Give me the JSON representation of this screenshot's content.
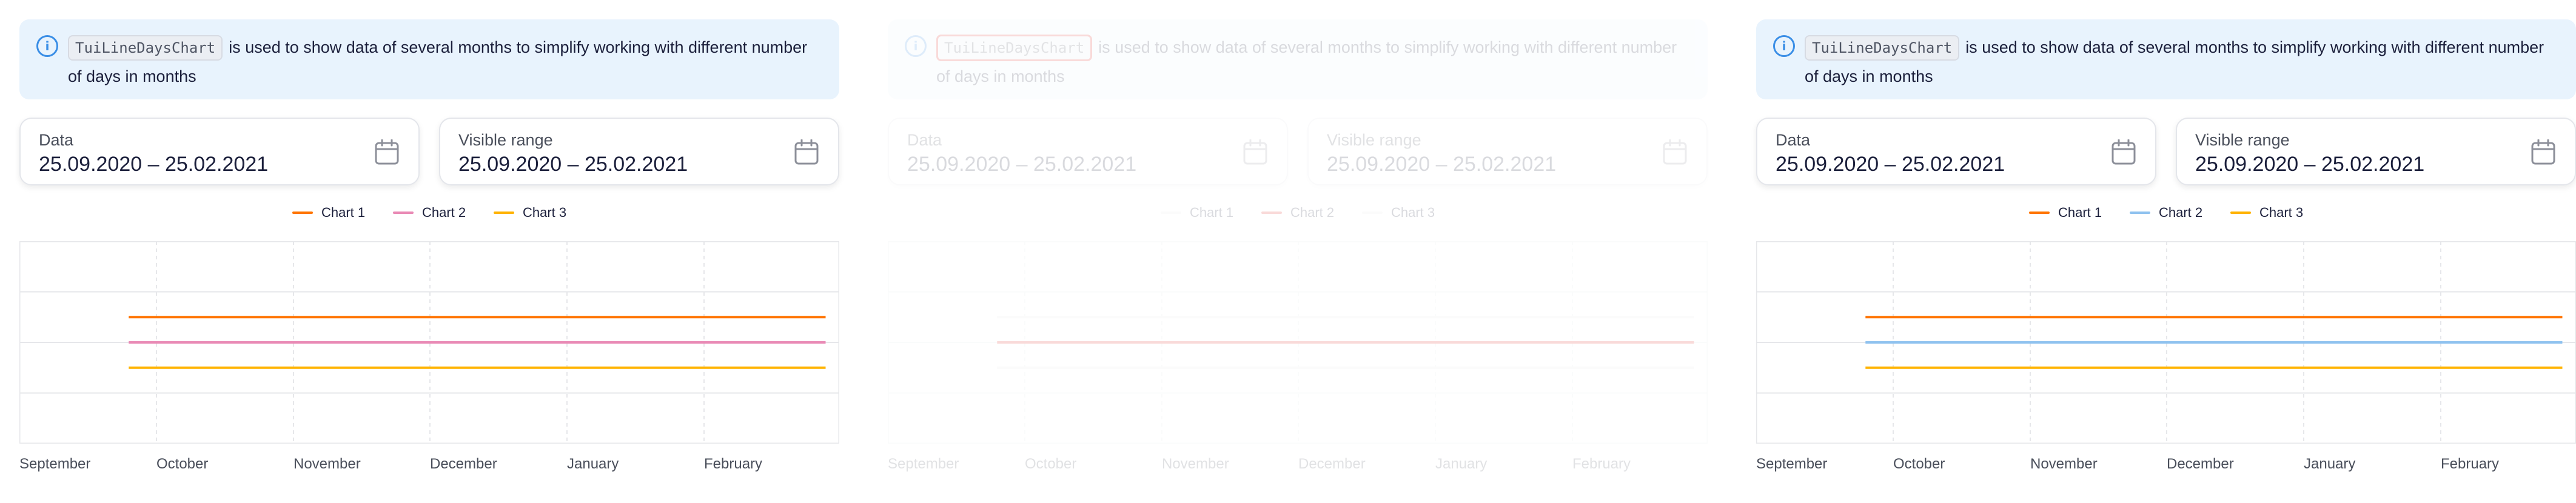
{
  "notice": {
    "code": "TuiLineDaysChart",
    "text": "is used to show data of several months to simplify working with different number of days in months"
  },
  "fields": {
    "data": {
      "label": "Data",
      "value": "25.09.2020 – 25.02.2021"
    },
    "visible_range": {
      "label": "Visible range",
      "value": "25.09.2020 – 25.02.2021"
    }
  },
  "legend": [
    "Chart 1",
    "Chart 2",
    "Chart 3"
  ],
  "panels": [
    {
      "colors": [
        "#ff7500",
        "#e98ab5",
        "#ffb300"
      ]
    },
    {
      "colors": [
        "#e7e7e7",
        "#e01f19",
        "#e7e7e7"
      ]
    },
    {
      "colors": [
        "#ff7500",
        "#8fc2ef",
        "#ffb300"
      ]
    }
  ],
  "chart_data": {
    "type": "line",
    "x_tick_labels": [
      "September",
      "October",
      "November",
      "December",
      "January",
      "February"
    ],
    "x_range": [
      "2020-09-01",
      "2021-02-28"
    ],
    "series": [
      {
        "name": "Chart 1",
        "x": [
          "2020-09-25",
          "2021-02-25"
        ],
        "y": [
          50,
          50
        ]
      },
      {
        "name": "Chart 2",
        "x": [
          "2020-09-25",
          "2021-02-25"
        ],
        "y": [
          40,
          40
        ]
      },
      {
        "name": "Chart 3",
        "x": [
          "2020-09-25",
          "2021-02-25"
        ],
        "y": [
          30,
          30
        ]
      }
    ],
    "ylim": [
      0,
      80
    ],
    "grid": true
  }
}
